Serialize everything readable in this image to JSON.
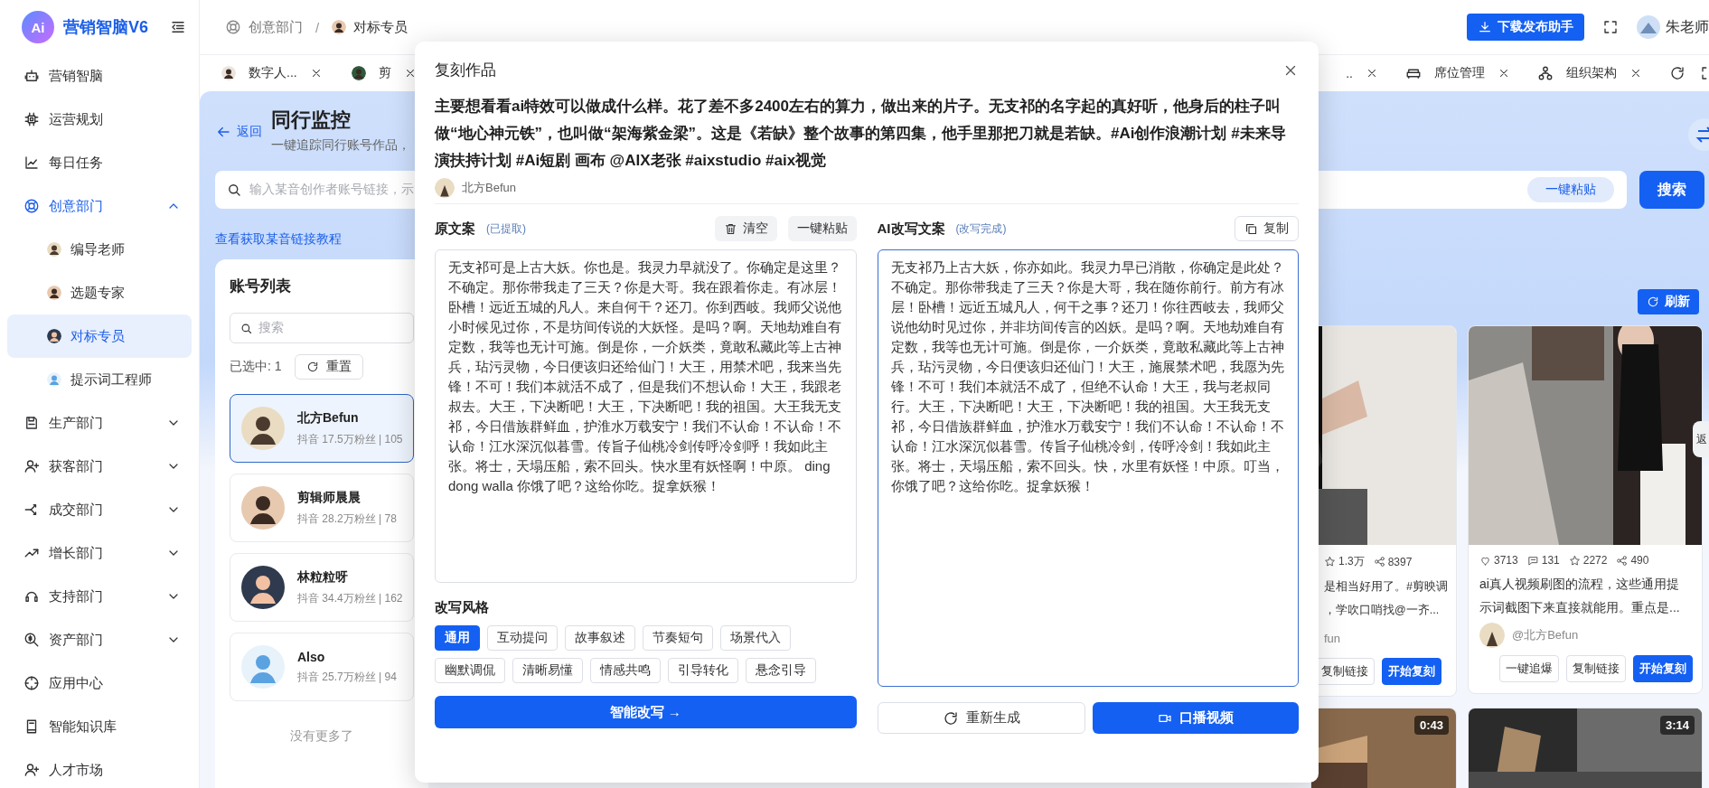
{
  "brand": {
    "logo_text": "Ai",
    "name": "营销智脑V6"
  },
  "nav": [
    {
      "kind": "link",
      "label": "营销智脑",
      "selected": false
    },
    {
      "kind": "link",
      "label": "运营规划",
      "selected": false
    },
    {
      "kind": "link",
      "label": "每日任务",
      "selected": false
    },
    {
      "kind": "group",
      "label": "创意部门",
      "expanded": true,
      "children": [
        {
          "label": "编导老师",
          "selected": false
        },
        {
          "label": "选题专家",
          "selected": false
        },
        {
          "label": "对标专员",
          "selected": true
        },
        {
          "label": "提示词工程师",
          "selected": false
        }
      ]
    },
    {
      "kind": "group",
      "label": "生产部门",
      "expanded": false
    },
    {
      "kind": "group",
      "label": "获客部门",
      "expanded": false
    },
    {
      "kind": "group",
      "label": "成交部门",
      "expanded": false
    },
    {
      "kind": "group",
      "label": "增长部门",
      "expanded": false
    },
    {
      "kind": "group",
      "label": "支持部门",
      "expanded": false
    },
    {
      "kind": "group",
      "label": "资产部门",
      "expanded": false
    },
    {
      "kind": "link",
      "label": "应用中心",
      "selected": false
    },
    {
      "kind": "link",
      "label": "智能知识库",
      "selected": false
    },
    {
      "kind": "link",
      "label": "人才市场",
      "selected": false
    }
  ],
  "breadcrumb": [
    "创意部门",
    "对标专员"
  ],
  "breadcrumb_separator": "/",
  "header": {
    "download_button": "下载发布助手",
    "user": "朱老师"
  },
  "tabs_left": [
    {
      "label": "数字人..."
    },
    {
      "label": "剪"
    }
  ],
  "tabs_right": [
    {
      "label": ".."
    },
    {
      "label": "席位管理"
    },
    {
      "label": "组织架构"
    }
  ],
  "page": {
    "back": "返回",
    "title": "同行监控",
    "subtitle": "一键追踪同行账号作品，",
    "search_placeholder": "输入某音创作者账号链接，示",
    "paste_button": "一键粘贴",
    "search_button": "搜索",
    "tutorial_link": "查看获取某音链接教程",
    "side_tab": "返"
  },
  "accounts": {
    "title": "账号列表",
    "search_placeholder": "搜索",
    "selected_count": "已选中: 1",
    "reset_button": "重置",
    "footer": "没有更多了",
    "items": [
      {
        "name": "北方Befun",
        "meta": "抖音 17.5万粉丝 | 105",
        "selected": true
      },
      {
        "name": "剪辑师晨晨",
        "meta": "抖音 28.2万粉丝 | 78",
        "selected": false
      },
      {
        "name": "林粒粒呀",
        "meta": "抖音 34.4万粉丝 | 162",
        "selected": false
      },
      {
        "name": "Also",
        "meta": "抖音 25.7万粉丝 | 94",
        "selected": false
      }
    ]
  },
  "videos": {
    "refresh_button": "刷新",
    "cards": [
      {
        "stats": [
          {
            "kind": "favorite",
            "value": "1.3万"
          },
          {
            "kind": "share",
            "value": "8397"
          }
        ],
        "description_lines": [
          "是相当好用了。#剪映调",
          "，学吹口哨找@一齐..."
        ],
        "author": "fun",
        "avatar": false,
        "buttons": [
          {
            "label": "复制链接",
            "primary": false
          },
          {
            "label": "开始复刻",
            "primary": true
          }
        ]
      },
      {
        "stats": [
          {
            "kind": "like",
            "value": "3713"
          },
          {
            "kind": "comment",
            "value": "131"
          },
          {
            "kind": "favorite",
            "value": "2272"
          },
          {
            "kind": "share",
            "value": "490"
          }
        ],
        "description_lines": [
          "ai真人视频刷图的流程，这些通用提",
          "示词截图下来直接就能用。重点是..."
        ],
        "author": "@北方Befun",
        "avatar": true,
        "buttons": [
          {
            "label": "一键追爆",
            "primary": false
          },
          {
            "label": "复制链接",
            "primary": false
          },
          {
            "label": "开始复刻",
            "primary": true
          }
        ]
      }
    ],
    "more_cards": [
      {
        "duration": "0:43"
      },
      {
        "duration": "3:14"
      }
    ]
  },
  "modal": {
    "title": "复刻作品",
    "description": "主要想看看ai特效可以做成什么样。花了差不多2400左右的算力，做出来的片子。无支祁的名字起的真好听，他身后的柱子叫做“地心神元铁”，也叫做“架海紫金梁”。这是《若缺》整个故事的第四集，他手里那把刀就是若缺。#Ai创作浪潮计划 #未来导演扶持计划 #Ai短剧 画布 @AIX老张 #aixstudio #aix视觉",
    "author": "北方Befun",
    "original": {
      "label": "原文案",
      "status": "(已提取)",
      "clear_button": "清空",
      "paste_button": "一键粘贴",
      "text": "无支祁可是上古大妖。你也是。我灵力早就没了。你确定是这里？不确定。那你带我走了三天？你是大哥。我在跟着你走。有冰层！卧槽！远近五城的凡人。来自何干？还刀。你到西岐。我师父说他小时候见过你，不是坊间传说的大妖怪。是吗？啊。天地劫难自有定数，我等也无计可施。倒是你，一介妖类，竟敢私藏此等上古神兵，玷污灵物，今日便该归还给仙门！大王，用禁术吧，我来当先锋！不可！我们本就活不成了，但是我们不想认命！大王，我跟老叔去。大王，下决断吧！大王，下决断吧！我的祖国。大王我无支祁，今日借族群鲜血，护淮水万载安宁！我们不认命！不认命！不认命！江水深沉似暮雪。传旨子仙桃冷剑传呼冷剑呼！我如此主张。将士，天塌压船，索不回头。快水里有妖怪啊！中原。 ding dong walla 你饿了吧？这给你吃。捉拿妖猴！"
    },
    "style_label": "改写风格",
    "styles": [
      {
        "label": "通用",
        "selected": true
      },
      {
        "label": "互动提问",
        "selected": false
      },
      {
        "label": "故事叙述",
        "selected": false
      },
      {
        "label": "节奏短句",
        "selected": false
      },
      {
        "label": "场景代入",
        "selected": false
      },
      {
        "label": "幽默调侃",
        "selected": false
      },
      {
        "label": "清晰易懂",
        "selected": false
      },
      {
        "label": "情感共鸣",
        "selected": false
      },
      {
        "label": "引导转化",
        "selected": false
      },
      {
        "label": "悬念引导",
        "selected": false
      }
    ],
    "rewrite_button": "智能改写 →",
    "rewritten": {
      "label": "AI改写文案",
      "status": "(改写完成)",
      "copy_button": "复制",
      "text": "无支祁乃上古大妖，你亦如此。我灵力早已消散，你确定是此处？不确定。那你带我走了三天？你是大哥，我在随你前行。前方有冰层！卧槽！远近五城凡人，何干之事？还刀！你往西岐去，我师父说他幼时见过你，并非坊间传言的凶妖。是吗？啊。天地劫难自有定数，我等也无计可施。倒是你，一介妖类，竟敢私藏此等上古神兵，玷污灵物，今日便该归还仙门！大王，施展禁术吧，我愿为先锋！不可！我们本就活不成了，但绝不认命！大王，我与老叔同行。大王，下决断吧！大王，下决断吧！我的祖国。大王我无支祁，今日借族群鲜血，护淮水万载安宁！我们不认命！不认命！不认命！江水深沉似暮雪。传旨子仙桃冷剑，传呼冷剑！我如此主张。将士，天塌压船，索不回头。快，水里有妖怪！中原。叮当，你饿了吧？这给你吃。捉拿妖猴！"
    },
    "regenerate_button": "重新生成",
    "video_button": "口播视频"
  }
}
